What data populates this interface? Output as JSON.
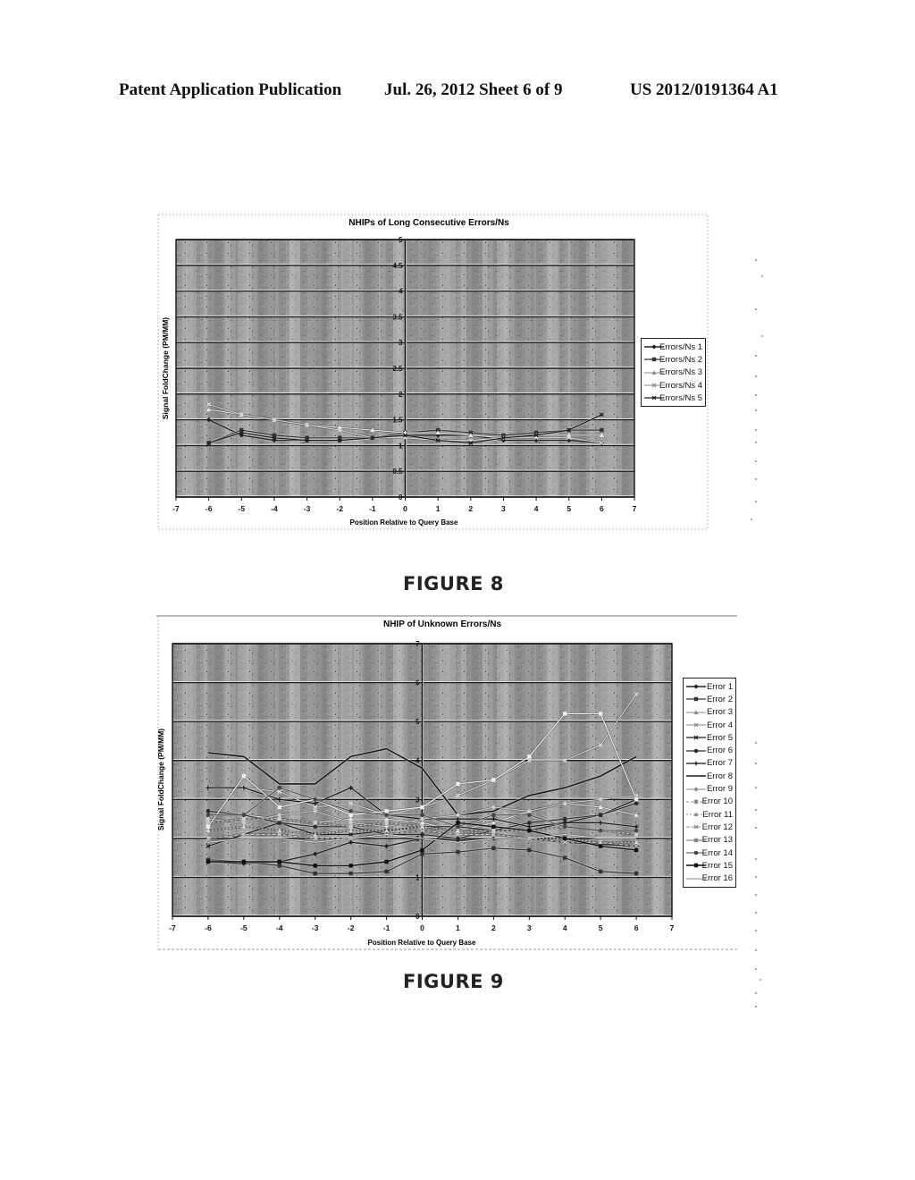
{
  "header": {
    "left": "Patent Application Publication",
    "middle": "Jul. 26, 2012   Sheet 6 of 9",
    "right": "US 2012/0191364 A1"
  },
  "figures": [
    {
      "label": "FIGURE 8"
    },
    {
      "label": "FIGURE 9"
    }
  ],
  "chart_data": [
    {
      "type": "line",
      "title": "NHIPs of Long Consecutive Errors/Ns",
      "xlabel": "Position Relative to Query Base",
      "ylabel": "Signal FoldChange (PM/MM)",
      "xlim": [
        -7,
        7
      ],
      "ylim": [
        0,
        5
      ],
      "xticks": [
        "-7",
        "-6",
        "-5",
        "-4",
        "-3",
        "-2",
        "-1",
        "0",
        "1",
        "2",
        "3",
        "4",
        "5",
        "6",
        "7"
      ],
      "yticks": [
        "0",
        "0.5",
        "1",
        "1.5",
        "2",
        "2.5",
        "3",
        "3.5",
        "4",
        "4.5",
        "5"
      ],
      "grid": true,
      "legend_position": "right",
      "x": [
        -6,
        -5,
        -4,
        -3,
        -2,
        -1,
        0,
        1,
        2,
        3,
        4,
        5,
        6
      ],
      "series": [
        {
          "name": "Errors/Ns 1",
          "values": [
            1.5,
            1.2,
            1.1,
            1.1,
            1.1,
            1.15,
            1.2,
            1.2,
            1.2,
            1.1,
            1.1,
            1.1,
            1.05
          ]
        },
        {
          "name": "Errors/Ns 2",
          "values": [
            1.05,
            1.3,
            1.2,
            1.15,
            1.15,
            1.15,
            1.25,
            1.3,
            1.25,
            1.2,
            1.25,
            1.3,
            1.3
          ]
        },
        {
          "name": "Errors/Ns 3",
          "values": [
            1.7,
            1.6,
            1.5,
            1.4,
            1.35,
            1.3,
            1.25,
            1.25,
            1.2,
            1.15,
            1.2,
            1.2,
            1.2
          ]
        },
        {
          "name": "Errors/Ns 4",
          "values": [
            1.8,
            1.6,
            1.5,
            1.4,
            1.3,
            1.15,
            1.15,
            1.1,
            1.1,
            1.15,
            1.15,
            1.15,
            1.05
          ]
        },
        {
          "name": "Errors/Ns 5",
          "values": [
            1.05,
            1.25,
            1.15,
            1.1,
            1.1,
            1.15,
            1.2,
            1.1,
            1.05,
            1.15,
            1.2,
            1.3,
            1.6
          ]
        }
      ]
    },
    {
      "type": "line",
      "title": "NHIP of Unknown Errors/Ns",
      "xlabel": "Position Relative to Query Base",
      "ylabel": "Signal FoldChange (PM/MM)",
      "xlim": [
        -7,
        7
      ],
      "ylim": [
        0,
        7
      ],
      "xticks": [
        "-7",
        "-6",
        "-5",
        "-4",
        "-3",
        "-2",
        "-1",
        "0",
        "1",
        "2",
        "3",
        "4",
        "5",
        "6",
        "7"
      ],
      "yticks": [
        "0",
        "1",
        "2",
        "3",
        "4",
        "5",
        "6",
        "7"
      ],
      "grid": true,
      "legend_position": "right",
      "x": [
        -6,
        -5,
        -4,
        -3,
        -2,
        -1,
        0,
        1,
        2,
        3,
        4,
        5,
        6
      ],
      "series": [
        {
          "name": "Error 1",
          "values": [
            1.4,
            1.35,
            1.4,
            1.6,
            1.9,
            1.8,
            2.0,
            1.95,
            2.0,
            2.0,
            1.9,
            1.85,
            1.8
          ]
        },
        {
          "name": "Error 2",
          "values": [
            1.45,
            1.4,
            1.3,
            1.1,
            1.1,
            1.15,
            1.6,
            1.65,
            1.75,
            1.7,
            1.5,
            1.15,
            1.1
          ]
        },
        {
          "name": "Error 3",
          "values": [
            2.6,
            2.6,
            2.5,
            2.4,
            2.5,
            2.5,
            2.4,
            2.2,
            2.4,
            2.7,
            2.9,
            2.8,
            2.6
          ]
        },
        {
          "name": "Error 4",
          "values": [
            3.3,
            3.3,
            3.2,
            2.8,
            2.9,
            2.6,
            2.8,
            3.1,
            3.5,
            4.0,
            4.0,
            4.4,
            5.7
          ]
        },
        {
          "name": "Error 5",
          "values": [
            1.8,
            2.1,
            2.4,
            2.1,
            2.1,
            2.2,
            2.3,
            2.3,
            2.2,
            2.2,
            2.4,
            2.6,
            3.0
          ]
        },
        {
          "name": "Error 6",
          "values": [
            2.7,
            2.6,
            2.4,
            2.3,
            2.3,
            2.1,
            2.1,
            2.0,
            2.2,
            2.4,
            2.5,
            2.6,
            2.9
          ]
        },
        {
          "name": "Error 7",
          "values": [
            3.3,
            3.3,
            3.0,
            2.9,
            3.3,
            2.6,
            2.5,
            2.5,
            2.5,
            2.3,
            2.4,
            2.4,
            2.3
          ]
        },
        {
          "name": "Error 8",
          "values": [
            4.2,
            4.1,
            3.4,
            3.4,
            4.1,
            4.3,
            3.8,
            2.6,
            2.7,
            3.1,
            3.3,
            3.6,
            4.1
          ]
        },
        {
          "name": "Error 9",
          "values": [
            2.5,
            2.4,
            2.6,
            2.7,
            2.4,
            2.3,
            2.5,
            2.6,
            2.8,
            2.7,
            2.9,
            3.0,
            3.1
          ]
        },
        {
          "name": "Error 10",
          "values": [
            2.4,
            2.5,
            2.5,
            2.4,
            2.3,
            2.4,
            2.3,
            2.2,
            2.2,
            2.2,
            2.3,
            2.2,
            2.1
          ]
        },
        {
          "name": "Error 11",
          "values": [
            2.2,
            2.3,
            2.2,
            2.1,
            2.2,
            2.2,
            2.3,
            2.2,
            2.1,
            2.0,
            2.0,
            1.9,
            1.9
          ]
        },
        {
          "name": "Error 12",
          "values": [
            2.0,
            2.1,
            2.1,
            2.0,
            2.0,
            2.1,
            2.2,
            2.1,
            2.1,
            2.0,
            1.9,
            1.9,
            1.8
          ]
        },
        {
          "name": "Error 13",
          "values": [
            2.3,
            3.6,
            2.8,
            3.0,
            2.6,
            2.7,
            2.8,
            3.4,
            3.5,
            4.1,
            5.2,
            5.2,
            3.0
          ]
        },
        {
          "name": "Error 14",
          "values": [
            2.6,
            2.6,
            3.3,
            3.0,
            2.7,
            2.6,
            2.6,
            2.3,
            2.6,
            2.6,
            2.3,
            2.2,
            2.2
          ]
        },
        {
          "name": "Error 15",
          "values": [
            1.4,
            1.4,
            1.4,
            1.3,
            1.3,
            1.4,
            1.7,
            2.4,
            2.3,
            2.2,
            2.0,
            1.8,
            1.7
          ]
        },
        {
          "name": "Error 16",
          "values": [
            1.9,
            2.0,
            2.0,
            1.9,
            2.0,
            2.1,
            2.0,
            1.9,
            2.0,
            2.0,
            2.1,
            2.0,
            2.0
          ]
        }
      ]
    }
  ]
}
